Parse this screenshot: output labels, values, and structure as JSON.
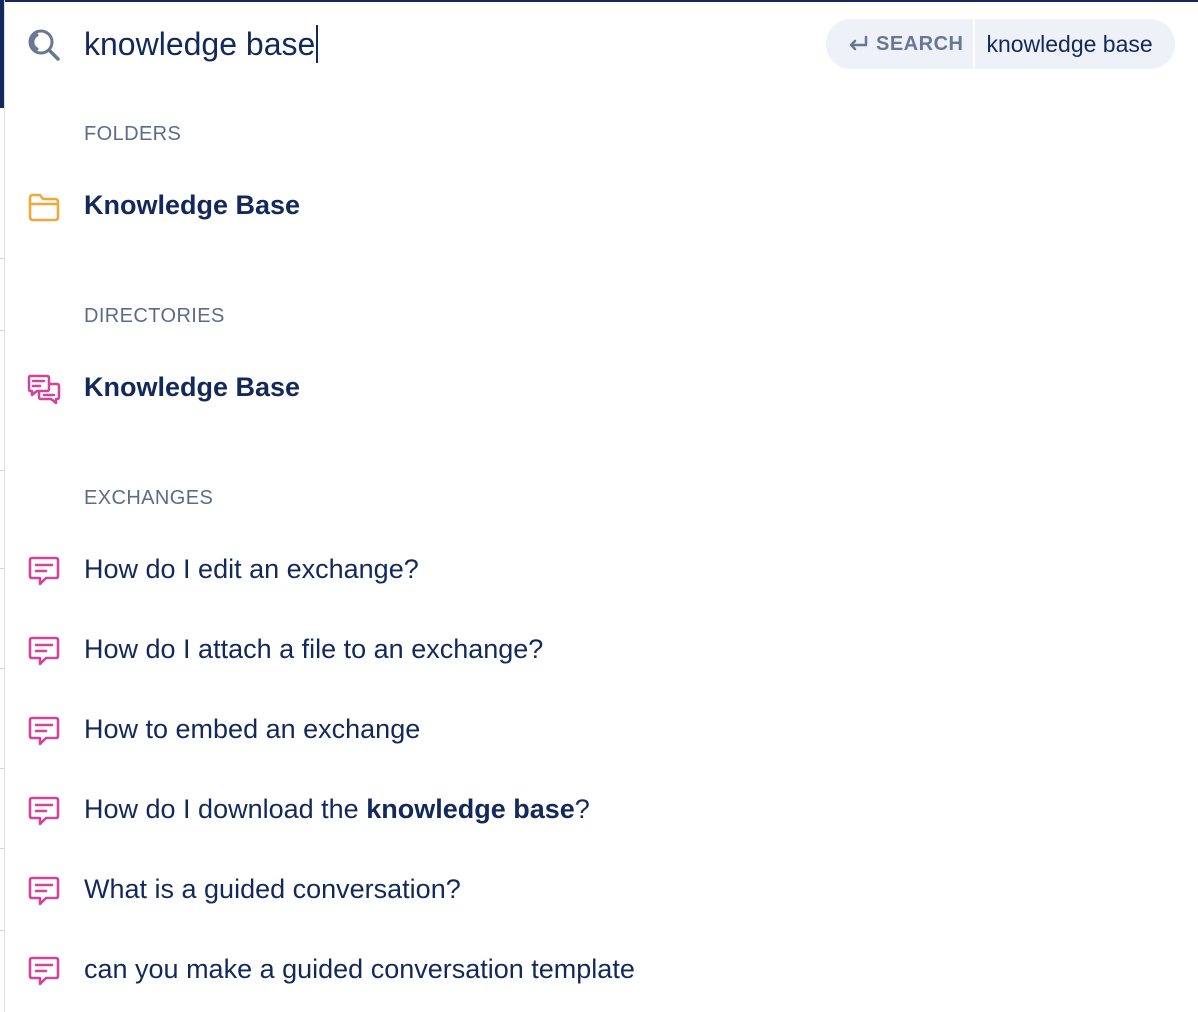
{
  "search": {
    "query": "knowledge base",
    "enter_label": "SEARCH",
    "pill_query": "knowledge base"
  },
  "sections": {
    "folders": {
      "label": "FOLDERS",
      "items": [
        {
          "label": "Knowledge Base",
          "icon": "folder-icon"
        }
      ]
    },
    "directories": {
      "label": "DIRECTORIES",
      "items": [
        {
          "label": "Knowledge Base",
          "icon": "directory-chat-icon"
        }
      ]
    },
    "exchanges": {
      "label": "EXCHANGES",
      "items": [
        {
          "label": "How do I edit an exchange?",
          "icon": "exchange-icon"
        },
        {
          "label": "How do I attach a file to an exchange?",
          "icon": "exchange-icon"
        },
        {
          "label": "How to embed an exchange",
          "icon": "exchange-icon"
        },
        {
          "label_prefix": "How do I download the ",
          "label_highlight": "knowledge base",
          "label_suffix": "?",
          "icon": "exchange-icon"
        },
        {
          "label": "What is a guided conversation?",
          "icon": "exchange-icon"
        },
        {
          "label": "can you make a guided conversation template",
          "icon": "exchange-icon"
        }
      ]
    }
  },
  "colors": {
    "text": "#13295c",
    "muted": "#5d6b89",
    "folder": "#f0a83c",
    "exchange": "#d0449a",
    "pill_bg": "#eef1f7"
  }
}
